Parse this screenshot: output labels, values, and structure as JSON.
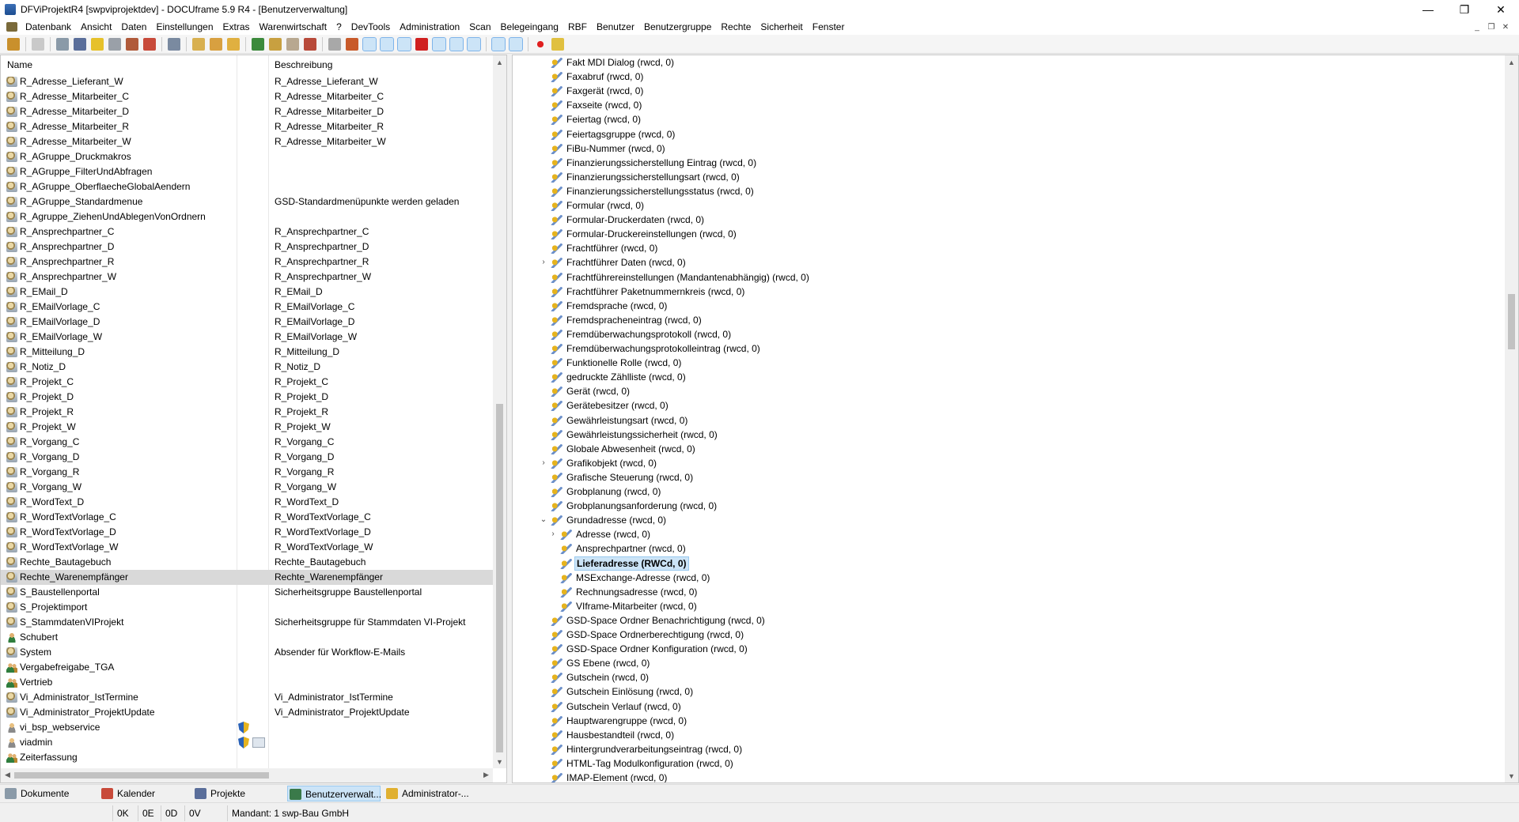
{
  "window": {
    "title": "DFViProjektR4 [swpviprojektdev] - DOCUframe 5.9 R4 - [Benutzerverwaltung]",
    "controls": [
      "—",
      "❐",
      "✕"
    ]
  },
  "menu": [
    "Datenbank",
    "Ansicht",
    "Daten",
    "Einstellungen",
    "Extras",
    "Warenwirtschaft",
    "?",
    "DevTools",
    "Administration",
    "Scan",
    "Belegeingang",
    "RBF",
    "Benutzer",
    "Benutzergruppe",
    "Rechte",
    "Sicherheit",
    "Fenster"
  ],
  "mdi_controls": [
    "_",
    "❐",
    "✕"
  ],
  "colors": {
    "selection": "#cce4f7",
    "selection_border": "#99c9ef",
    "row_selected": "#d9d9d9"
  },
  "left_panel": {
    "columns": {
      "name": "Name",
      "description": "Beschreibung"
    },
    "rows": [
      {
        "icon": "group-icon",
        "name": "R_Adresse_Lieferant_W",
        "desc": "R_Adresse_Lieferant_W"
      },
      {
        "icon": "group-icon",
        "name": "R_Adresse_Mitarbeiter_C",
        "desc": "R_Adresse_Mitarbeiter_C"
      },
      {
        "icon": "group-icon",
        "name": "R_Adresse_Mitarbeiter_D",
        "desc": "R_Adresse_Mitarbeiter_D"
      },
      {
        "icon": "group-icon",
        "name": "R_Adresse_Mitarbeiter_R",
        "desc": "R_Adresse_Mitarbeiter_R"
      },
      {
        "icon": "group-icon",
        "name": "R_Adresse_Mitarbeiter_W",
        "desc": "R_Adresse_Mitarbeiter_W"
      },
      {
        "icon": "group-icon",
        "name": "R_AGruppe_Druckmakros",
        "desc": ""
      },
      {
        "icon": "group-icon",
        "name": "R_AGruppe_FilterUndAbfragen",
        "desc": ""
      },
      {
        "icon": "group-icon",
        "name": "R_AGruppe_OberflaecheGlobalAendern",
        "desc": ""
      },
      {
        "icon": "group-icon",
        "name": "R_AGruppe_Standardmenue",
        "desc": "GSD-Standardmenüpunkte werden geladen"
      },
      {
        "icon": "group-icon",
        "name": "R_Agruppe_ZiehenUndAblegenVonOrdnern",
        "desc": ""
      },
      {
        "icon": "group-icon",
        "name": "R_Ansprechpartner_C",
        "desc": "R_Ansprechpartner_C"
      },
      {
        "icon": "group-icon",
        "name": "R_Ansprechpartner_D",
        "desc": "R_Ansprechpartner_D"
      },
      {
        "icon": "group-icon",
        "name": "R_Ansprechpartner_R",
        "desc": "R_Ansprechpartner_R"
      },
      {
        "icon": "group-icon",
        "name": "R_Ansprechpartner_W",
        "desc": "R_Ansprechpartner_W"
      },
      {
        "icon": "group-icon",
        "name": "R_EMail_D",
        "desc": "R_EMail_D"
      },
      {
        "icon": "group-icon",
        "name": "R_EMailVorlage_C",
        "desc": "R_EMailVorlage_C"
      },
      {
        "icon": "group-icon",
        "name": "R_EMailVorlage_D",
        "desc": "R_EMailVorlage_D"
      },
      {
        "icon": "group-icon",
        "name": "R_EMailVorlage_W",
        "desc": "R_EMailVorlage_W"
      },
      {
        "icon": "group-icon",
        "name": "R_Mitteilung_D",
        "desc": "R_Mitteilung_D"
      },
      {
        "icon": "group-icon",
        "name": "R_Notiz_D",
        "desc": "R_Notiz_D"
      },
      {
        "icon": "group-icon",
        "name": "R_Projekt_C",
        "desc": "R_Projekt_C"
      },
      {
        "icon": "group-icon",
        "name": "R_Projekt_D",
        "desc": "R_Projekt_D"
      },
      {
        "icon": "group-icon",
        "name": "R_Projekt_R",
        "desc": "R_Projekt_R"
      },
      {
        "icon": "group-icon",
        "name": "R_Projekt_W",
        "desc": "R_Projekt_W"
      },
      {
        "icon": "group-icon",
        "name": "R_Vorgang_C",
        "desc": "R_Vorgang_C"
      },
      {
        "icon": "group-icon",
        "name": "R_Vorgang_D",
        "desc": "R_Vorgang_D"
      },
      {
        "icon": "group-icon",
        "name": "R_Vorgang_R",
        "desc": "R_Vorgang_R"
      },
      {
        "icon": "group-icon",
        "name": "R_Vorgang_W",
        "desc": "R_Vorgang_W"
      },
      {
        "icon": "group-icon",
        "name": "R_WordText_D",
        "desc": "R_WordText_D"
      },
      {
        "icon": "group-icon",
        "name": "R_WordTextVorlage_C",
        "desc": "R_WordTextVorlage_C"
      },
      {
        "icon": "group-icon",
        "name": "R_WordTextVorlage_D",
        "desc": "R_WordTextVorlage_D"
      },
      {
        "icon": "group-icon",
        "name": "R_WordTextVorlage_W",
        "desc": "R_WordTextVorlage_W"
      },
      {
        "icon": "group-icon",
        "name": "Rechte_Bautagebuch",
        "desc": "Rechte_Bautagebuch"
      },
      {
        "icon": "group-icon",
        "name": "Rechte_Warenempfänger",
        "desc": "Rechte_Warenempfänger",
        "selected": true
      },
      {
        "icon": "group-icon",
        "name": "S_Baustellenportal",
        "desc": "Sicherheitsgruppe Baustellenportal"
      },
      {
        "icon": "group-icon",
        "name": "S_Projektimport",
        "desc": ""
      },
      {
        "icon": "group-icon",
        "name": "S_StammdatenVIProjekt",
        "desc": "Sicherheitsgruppe für Stammdaten VI-Projekt"
      },
      {
        "icon": "user-icon",
        "name": "Schubert",
        "desc": ""
      },
      {
        "icon": "group-icon",
        "name": "System",
        "desc": "Absender für Workflow-E-Mails"
      },
      {
        "icon": "user-group-icon",
        "name": "Vergabefreigabe_TGA",
        "desc": ""
      },
      {
        "icon": "user-group-icon",
        "name": "Vertrieb",
        "desc": ""
      },
      {
        "icon": "group-icon",
        "name": "Vi_Administrator_IstTermine",
        "desc": "Vi_Administrator_IstTermine"
      },
      {
        "icon": "group-icon",
        "name": "Vi_Administrator_ProjektUpdate",
        "desc": "Vi_Administrator_ProjektUpdate"
      },
      {
        "icon": "web-user-icon",
        "name": "vi_bsp_webservice",
        "desc": "",
        "shield": true
      },
      {
        "icon": "web-user-icon",
        "name": "viadmin",
        "desc": "",
        "shield": true,
        "extra": true
      },
      {
        "icon": "user-group-icon",
        "name": "Zeiterfassung",
        "desc": ""
      }
    ]
  },
  "right_panel": {
    "items": [
      {
        "label": "Fakt MDI Dialog (rwcd, 0)",
        "level": 0
      },
      {
        "label": "Faxabruf (rwcd, 0)",
        "level": 0
      },
      {
        "label": "Faxgerät (rwcd, 0)",
        "level": 0
      },
      {
        "label": "Faxseite (rwcd, 0)",
        "level": 0
      },
      {
        "label": "Feiertag (rwcd, 0)",
        "level": 0
      },
      {
        "label": "Feiertagsgruppe (rwcd, 0)",
        "level": 0
      },
      {
        "label": "FiBu-Nummer (rwcd, 0)",
        "level": 0
      },
      {
        "label": "Finanzierungssicherstellung Eintrag (rwcd, 0)",
        "level": 0
      },
      {
        "label": "Finanzierungssicherstellungsart (rwcd, 0)",
        "level": 0
      },
      {
        "label": "Finanzierungssicherstellungsstatus (rwcd, 0)",
        "level": 0
      },
      {
        "label": "Formular (rwcd, 0)",
        "level": 0
      },
      {
        "label": "Formular-Druckerdaten (rwcd, 0)",
        "level": 0
      },
      {
        "label": "Formular-Druckereinstellungen (rwcd, 0)",
        "level": 0
      },
      {
        "label": "Frachtführer (rwcd, 0)",
        "level": 0
      },
      {
        "label": "Frachtführer Daten (rwcd, 0)",
        "level": 0,
        "expander": "›"
      },
      {
        "label": "Frachtführereinstellungen (Mandantenabhängig) (rwcd, 0)",
        "level": 0
      },
      {
        "label": "Frachtführer Paketnummernkreis (rwcd, 0)",
        "level": 0
      },
      {
        "label": "Fremdsprache (rwcd, 0)",
        "level": 0
      },
      {
        "label": "Fremdspracheneintrag (rwcd, 0)",
        "level": 0
      },
      {
        "label": "Fremdüberwachungsprotokoll (rwcd, 0)",
        "level": 0
      },
      {
        "label": "Fremdüberwachungsprotokolleintrag (rwcd, 0)",
        "level": 0
      },
      {
        "label": "Funktionelle Rolle (rwcd, 0)",
        "level": 0
      },
      {
        "label": "gedruckte Zählliste (rwcd, 0)",
        "level": 0
      },
      {
        "label": "Gerät (rwcd, 0)",
        "level": 0
      },
      {
        "label": "Gerätebesitzer (rwcd, 0)",
        "level": 0
      },
      {
        "label": "Gewährleistungsart (rwcd, 0)",
        "level": 0
      },
      {
        "label": "Gewährleistungssicherheit (rwcd, 0)",
        "level": 0
      },
      {
        "label": "Globale Abwesenheit (rwcd, 0)",
        "level": 0
      },
      {
        "label": "Grafikobjekt (rwcd, 0)",
        "level": 0,
        "expander": "›"
      },
      {
        "label": "Grafische Steuerung (rwcd, 0)",
        "level": 0
      },
      {
        "label": "Grobplanung (rwcd, 0)",
        "level": 0
      },
      {
        "label": "Grobplanungsanforderung (rwcd, 0)",
        "level": 0
      },
      {
        "label": "Grundadresse (rwcd, 0)",
        "level": 0,
        "expander": "⌄"
      },
      {
        "label": "Adresse (rwcd, 0)",
        "level": 1,
        "expander": "›"
      },
      {
        "label": "Ansprechpartner (rwcd, 0)",
        "level": 1
      },
      {
        "label": "Lieferadresse (RWCd, 0)",
        "level": 1,
        "selected": true
      },
      {
        "label": "MSExchange-Adresse (rwcd, 0)",
        "level": 1
      },
      {
        "label": "Rechnungsadresse (rwcd, 0)",
        "level": 1
      },
      {
        "label": "VIframe-Mitarbeiter (rwcd, 0)",
        "level": 1
      },
      {
        "label": "GSD-Space Ordner Benachrichtigung (rwcd, 0)",
        "level": 0
      },
      {
        "label": "GSD-Space Ordnerberechtigung (rwcd, 0)",
        "level": 0
      },
      {
        "label": "GSD-Space Ordner Konfiguration (rwcd, 0)",
        "level": 0
      },
      {
        "label": "GS Ebene (rwcd, 0)",
        "level": 0
      },
      {
        "label": "Gutschein (rwcd, 0)",
        "level": 0
      },
      {
        "label": "Gutschein Einlösung (rwcd, 0)",
        "level": 0
      },
      {
        "label": "Gutschein Verlauf (rwcd, 0)",
        "level": 0
      },
      {
        "label": "Hauptwarengruppe (rwcd, 0)",
        "level": 0
      },
      {
        "label": "Hausbestandteil (rwcd, 0)",
        "level": 0
      },
      {
        "label": "Hintergrundverarbeitungseintrag (rwcd, 0)",
        "level": 0
      },
      {
        "label": "HTML-Tag Modulkonfiguration (rwcd, 0)",
        "level": 0
      },
      {
        "label": "IMAP-Element (rwcd, 0)",
        "level": 0
      }
    ]
  },
  "taskbar": [
    {
      "label": "Dokumente",
      "icon": "documents-icon"
    },
    {
      "label": "Kalender",
      "icon": "calendar-icon"
    },
    {
      "label": "Projekte",
      "icon": "projects-icon"
    },
    {
      "label": "Benutzerverwalt...",
      "icon": "user-admin-icon",
      "active": true
    },
    {
      "label": "Administrator-...",
      "icon": "admin-icon"
    }
  ],
  "status": {
    "k": "0K",
    "e": "0E",
    "d": "0D",
    "v": "0V",
    "mandant": "Mandant: 1 swp-Bau GmbH"
  }
}
